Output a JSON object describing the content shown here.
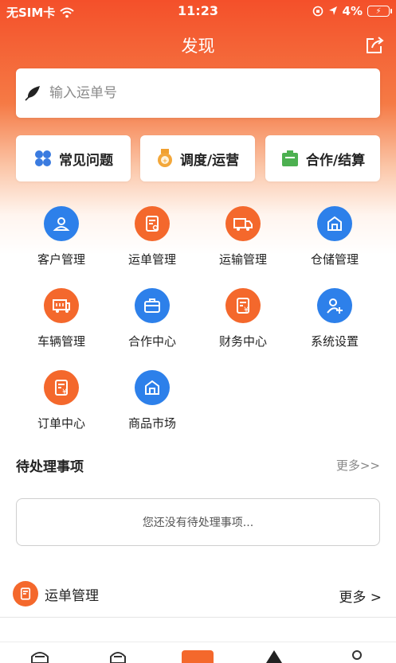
{
  "status_bar": {
    "carrier": "无SIM卡",
    "time": "11:23",
    "battery": "4%"
  },
  "nav": {
    "title": "发现"
  },
  "search": {
    "placeholder": "输入运单号",
    "value": ""
  },
  "quick_actions": [
    {
      "label": "常见问题",
      "icon": "clover-icon"
    },
    {
      "label": "调度/运营",
      "icon": "medal-icon"
    },
    {
      "label": "合作/结算",
      "icon": "battery-icon"
    }
  ],
  "grid": [
    {
      "label": "客户管理",
      "icon": "customer-icon",
      "color": "#2d80ea"
    },
    {
      "label": "运单管理",
      "icon": "waybill-icon",
      "color": "#f4682c"
    },
    {
      "label": "运输管理",
      "icon": "truck-icon",
      "color": "#f4682c"
    },
    {
      "label": "仓储管理",
      "icon": "warehouse-icon",
      "color": "#2d80ea"
    },
    {
      "label": "车辆管理",
      "icon": "vehicle-icon",
      "color": "#f4682c"
    },
    {
      "label": "合作中心",
      "icon": "briefcase-icon",
      "color": "#2d80ea"
    },
    {
      "label": "财务中心",
      "icon": "finance-icon",
      "color": "#f4682c"
    },
    {
      "label": "系统设置",
      "icon": "add-user-icon",
      "color": "#2d80ea"
    },
    {
      "label": "订单中心",
      "icon": "order-icon",
      "color": "#f4682c"
    },
    {
      "label": "商品市场",
      "icon": "market-icon",
      "color": "#2d80ea"
    }
  ],
  "pending": {
    "title": "待处理事项",
    "more": "更多>>",
    "empty_text": "您还没有待处理事项..."
  },
  "waybill_section": {
    "title": "运单管理",
    "more": "更多 >"
  },
  "colors": {
    "accent": "#f4502a",
    "orange": "#f4682c",
    "blue": "#2d80ea"
  }
}
